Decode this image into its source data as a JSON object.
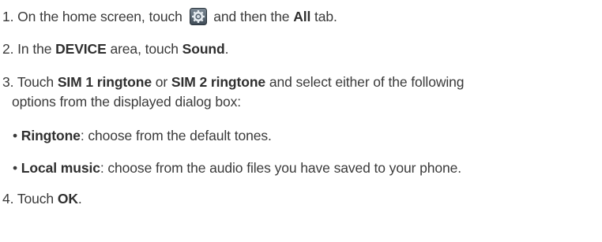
{
  "step1": {
    "prefix": "1. On the home screen, touch",
    "icon": "settings-icon",
    "middle": "and then the",
    "tab": "All",
    "suffix": "tab."
  },
  "step2": {
    "prefix": "2. In the",
    "area": "DEVICE",
    "middle": "area, touch",
    "target": "Sound",
    "suffix": "."
  },
  "step3": {
    "prefix": "3. Touch",
    "option1": "SIM 1 ringtone",
    "or": "or",
    "option2": "SIM 2 ringtone",
    "suffix": "and select either of the following",
    "continuation": "options from the displayed dialog box:",
    "bullets": [
      {
        "marker": "•",
        "label": "Ringtone",
        "text": ": choose from the default tones."
      },
      {
        "marker": "•",
        "label": "Local music",
        "text": ": choose from the audio files you have saved to your phone."
      }
    ]
  },
  "step4": {
    "prefix": "4. Touch",
    "button": "OK",
    "suffix": "."
  }
}
